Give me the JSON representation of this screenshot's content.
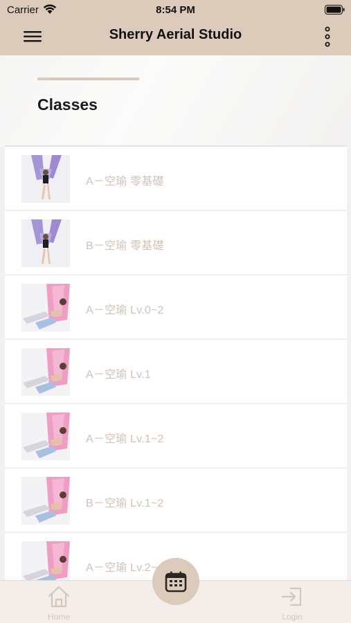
{
  "status_bar": {
    "carrier": "Carrier",
    "time": "8:54 PM"
  },
  "app_bar": {
    "title": "Sherry Aerial Studio",
    "menu_icon": "hamburger-icon",
    "more_icon": "more-vertical-icon"
  },
  "section": {
    "title": "Classes"
  },
  "classes": [
    {
      "label": "A－空瑜 零基礎",
      "thumb": "purple"
    },
    {
      "label": "B－空瑜 零基礎",
      "thumb": "purple"
    },
    {
      "label": "A－空瑜 Lv.0~2",
      "thumb": "pink"
    },
    {
      "label": "A－空瑜 Lv.1",
      "thumb": "pink"
    },
    {
      "label": "A－空瑜 Lv.1~2",
      "thumb": "pink"
    },
    {
      "label": "B－空瑜 Lv.1~2",
      "thumb": "pink"
    },
    {
      "label": "A－空瑜 Lv.2~4",
      "thumb": "pink"
    }
  ],
  "tab_bar": {
    "home_label": "Home",
    "login_label": "Login",
    "fab_icon": "calendar-icon"
  },
  "colors": {
    "accent": "#dccabb",
    "label": "#d0c2b6",
    "tab_label": "#d4c6ba"
  }
}
